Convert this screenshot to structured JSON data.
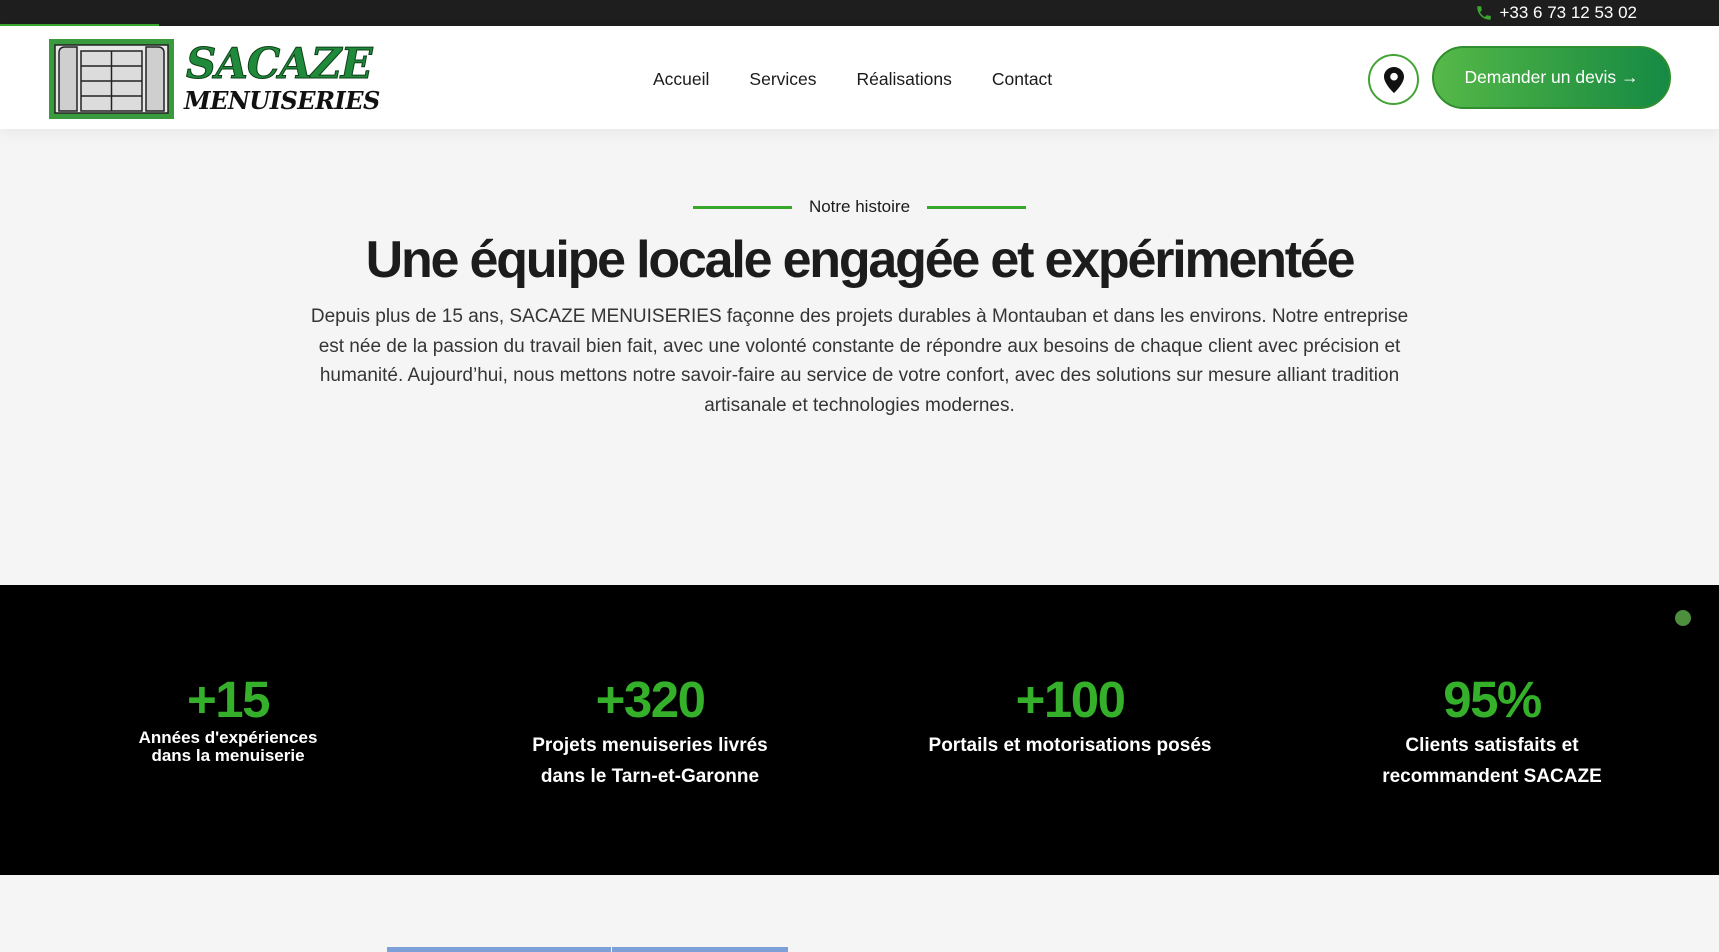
{
  "topbar": {
    "phone": "+33 6 73 12 53 02",
    "phone_icon": "phone-icon"
  },
  "header": {
    "logo_name": "SACAZE",
    "logo_sub": "MENUISERIES",
    "nav": [
      "Accueil",
      "Services",
      "Réalisations",
      "Contact"
    ],
    "location_icon": "map-pin-icon",
    "cta_label": "Demander un devis →"
  },
  "story": {
    "eyebrow": "Notre histoire",
    "title": "Une équipe locale engagée et expérimentée",
    "description": "Depuis plus de 15 ans, SACAZE MENUISERIES façonne des projets durables à Montauban et dans les environs. Notre entreprise est née de la passion du travail bien fait, avec une volonté constante de répondre aux besoins de chaque client avec précision et humanité. Aujourd’hui, nous mettons notre savoir-faire au service de votre confort, avec des solutions sur mesure alliant tradition artisanale et technologies modernes."
  },
  "stats": [
    {
      "value": "+15",
      "line1": "Années d'expériences",
      "line2": "dans la menuiserie"
    },
    {
      "value": "+320",
      "line1": "Projets menuiseries livrés",
      "line2": "dans le Tarn-et-Garonne"
    },
    {
      "value": "+100",
      "line1": "Portails et motorisations posés",
      "line2": ""
    },
    {
      "value": "95%",
      "line1": "Clients satisfaits et",
      "line2": "recommandent SACAZE"
    }
  ],
  "colors": {
    "accent": "#35b02a",
    "dark": "#000000",
    "topbar": "#1e1e1e",
    "background": "#f5f5f5"
  }
}
